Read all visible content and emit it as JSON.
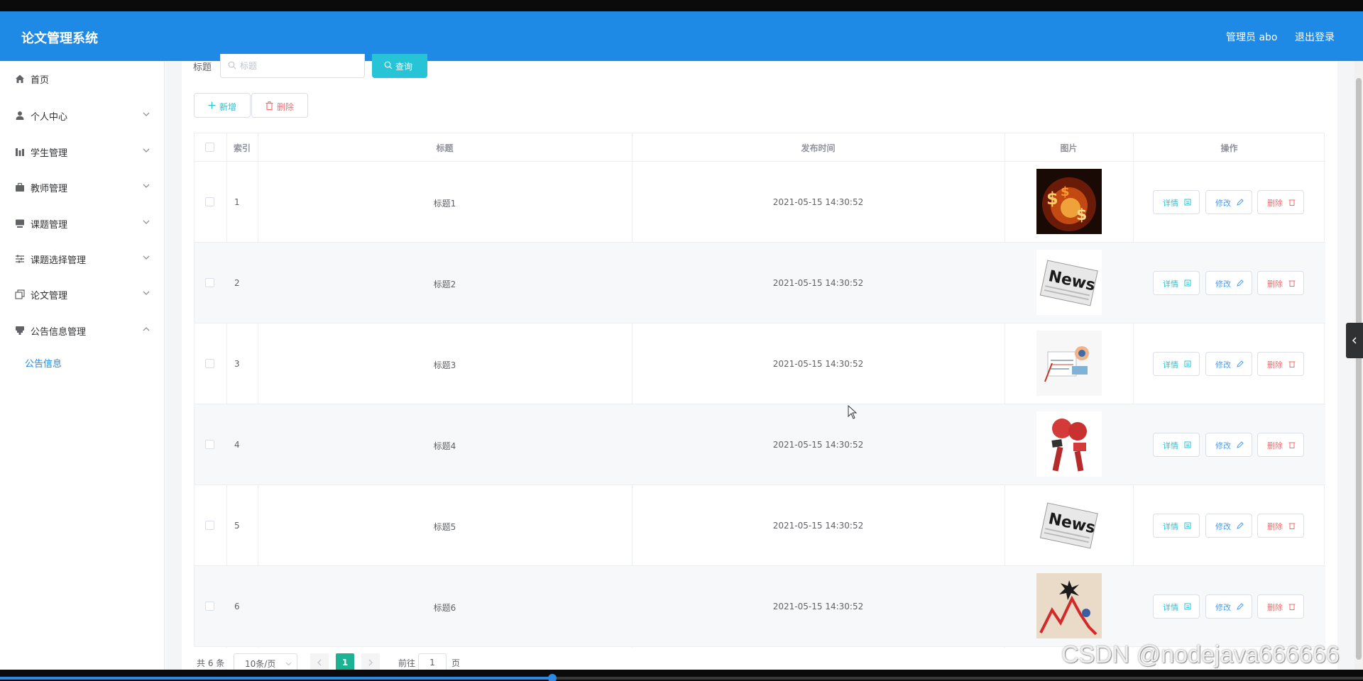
{
  "header": {
    "brand": "论文管理系统",
    "user": "管理员 abo",
    "logout": "退出登录"
  },
  "sidebar": {
    "items": [
      {
        "label": "首页",
        "icon": "home-icon",
        "expandable": false
      },
      {
        "label": "个人中心",
        "icon": "user-icon",
        "expandable": true
      },
      {
        "label": "学生管理",
        "icon": "chart-icon",
        "expandable": true
      },
      {
        "label": "教师管理",
        "icon": "briefcase-icon",
        "expandable": true
      },
      {
        "label": "课题管理",
        "icon": "monitor-icon",
        "expandable": true
      },
      {
        "label": "课题选择管理",
        "icon": "sliders-icon",
        "expandable": true
      },
      {
        "label": "论文管理",
        "icon": "copy-icon",
        "expandable": true
      },
      {
        "label": "公告信息管理",
        "icon": "notice-icon",
        "expandable": true,
        "expanded": true
      }
    ],
    "subitems": [
      {
        "label": "公告信息",
        "active": true
      }
    ]
  },
  "search": {
    "label": "标题",
    "placeholder": "标题",
    "button": "查询"
  },
  "actions": {
    "add": "新增",
    "delete": "删除"
  },
  "table": {
    "headers": {
      "index": "索引",
      "title": "标题",
      "published": "发布时间",
      "image": "图片",
      "ops": "操作"
    },
    "rows": [
      {
        "index": "1",
        "title": "标题1",
        "published": "2021-05-15 14:30:52",
        "image": "fire-money"
      },
      {
        "index": "2",
        "title": "标题2",
        "published": "2021-05-15 14:30:52",
        "image": "news-paper"
      },
      {
        "index": "3",
        "title": "标题3",
        "published": "2021-05-15 14:30:52",
        "image": "news-illustration"
      },
      {
        "index": "4",
        "title": "标题4",
        "published": "2021-05-15 14:30:52",
        "image": "live-microphones"
      },
      {
        "index": "5",
        "title": "标题5",
        "published": "2021-05-15 14:30:52",
        "image": "news-paper"
      },
      {
        "index": "6",
        "title": "标题6",
        "published": "2021-05-15 14:30:52",
        "image": "market-crash"
      }
    ],
    "op_labels": {
      "detail": "详情",
      "edit": "修改",
      "remove": "删除"
    }
  },
  "pagination": {
    "total": "共 6 条",
    "page_size": "10条/页",
    "current_page": "1",
    "goto_label": "前往",
    "goto_value": "1",
    "unit": "页"
  },
  "watermark": "CSDN @nodejava666666",
  "video_progress": 0.405,
  "colors": {
    "header": "#1f89e6",
    "primary": "#27c3d6",
    "danger": "#f56c6c",
    "edit": "#409eff",
    "page_active": "#1bb394"
  }
}
